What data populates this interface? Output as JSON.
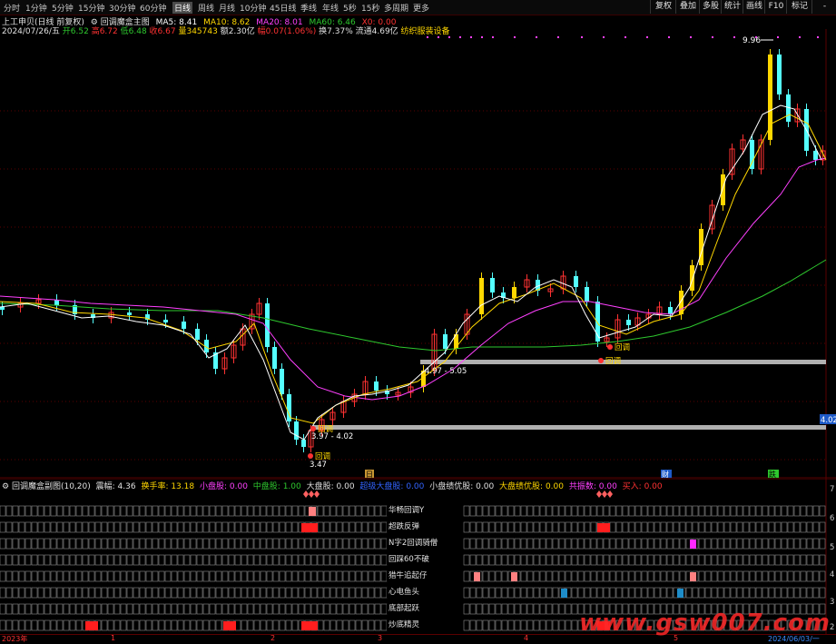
{
  "toolbar": {
    "timeframes": [
      "分时",
      "1分钟",
      "5分钟",
      "15分钟",
      "30分钟",
      "60分钟",
      "日线",
      "周线",
      "月线",
      "10分钟",
      "45日线",
      "季线",
      "年线",
      "5秒",
      "15秒",
      "多周期",
      "更多"
    ],
    "active": "日线",
    "buttons": [
      "复权",
      "叠加",
      "多股",
      "统计",
      "画线",
      "F10",
      "标记",
      "-"
    ]
  },
  "main_header": {
    "title": "上工申贝(日线 前复权)",
    "indicator": "回调魔盒主图",
    "ma5": "MA5: 8.41",
    "ma10": "MA10: 8.62",
    "ma20": "MA20: 8.01",
    "ma60": "MA60: 6.46",
    "x0": "X0: 0.00"
  },
  "quote": {
    "date": "2024/07/26/五",
    "open": "开6.52",
    "high": "高6.72",
    "low": "低6.48",
    "close": "收6.67",
    "volume": "量345743",
    "amount": "额2.30亿",
    "change": "幅0.07(1.06%)",
    "turnover": "换7.37%",
    "float": "流通4.69亿",
    "sector": "纺织服装设备"
  },
  "annotations": {
    "high_label": "9.96",
    "range1": "4.97 - 5.05",
    "range2": "3.97 - 4.02",
    "low_label": "3.47",
    "pullback": "回调",
    "price_tag": "4.02",
    "marker_ri": "日",
    "marker_cai": "财",
    "marker_die": "跌"
  },
  "sub_header": {
    "name": "回调魔盒副图(10,20)",
    "amplitude": "震幅: 4.36",
    "turnover": "换手率: 13.18",
    "small": "小盘股: 0.00",
    "mid": "中盘股: 1.00",
    "large": "大盘股: 0.00",
    "super": "超级大盘股: 0.00",
    "small_good": "小盘绩优股: 0.00",
    "large_good": "大盘绩优股: 0.00",
    "st": "共振数: 0.00",
    "buy": "买入: 0.00"
  },
  "signal_rows": [
    "华畅回调Y",
    "超跌反弹",
    "N字2回调骑僧",
    "回踩60不破",
    "猎牛追起仔",
    "心电鱼头",
    "底部起跃",
    "炒底精灵"
  ],
  "sub_axis": [
    "7",
    "6",
    "5",
    "4",
    "3",
    "2"
  ],
  "date_axis": [
    "2023年",
    "1",
    "2",
    "3",
    "4",
    "5",
    "2024/06/03/一"
  ],
  "watermark": "www.gsw007.com",
  "colors": {
    "up": "#ff3232",
    "down": "#54ffff",
    "yellow": "#ffd700",
    "ma5": "#ffffff",
    "ma10": "#ffd700",
    "ma20": "#ff40ff",
    "ma60": "#2ec82e"
  }
}
